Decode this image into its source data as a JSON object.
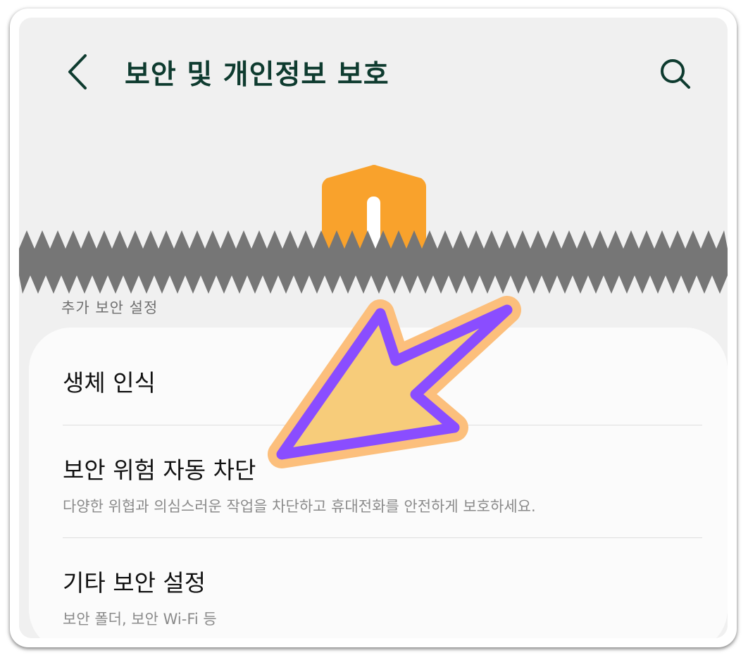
{
  "header": {
    "title": "보안 및 개인정보 보호",
    "back_icon": "chevron-left-icon",
    "search_icon": "search-icon"
  },
  "hero": {
    "icon": "shield-icon",
    "accent": "#f9a22c"
  },
  "section": {
    "label": "추가 보안 설정"
  },
  "items": [
    {
      "title": "생체 인식",
      "subtitle": ""
    },
    {
      "title": "보안 위험 자동 차단",
      "subtitle": "다양한 위협과 의심스러운 작업을 차단하고 휴대전화를 안전하게 보호하세요."
    },
    {
      "title": "기타 보안 설정",
      "subtitle": "보안 폴더, 보안 Wi-Fi 등"
    }
  ],
  "colors": {
    "title": "#0e3b2f",
    "screen_bg": "#f0f0f0",
    "card_bg": "#fbfbfb",
    "torn_band": "#767676",
    "arrow_fill": "#f7cc7a",
    "arrow_stroke": "#8a4dff",
    "arrow_glow": "#fcbf7c"
  }
}
